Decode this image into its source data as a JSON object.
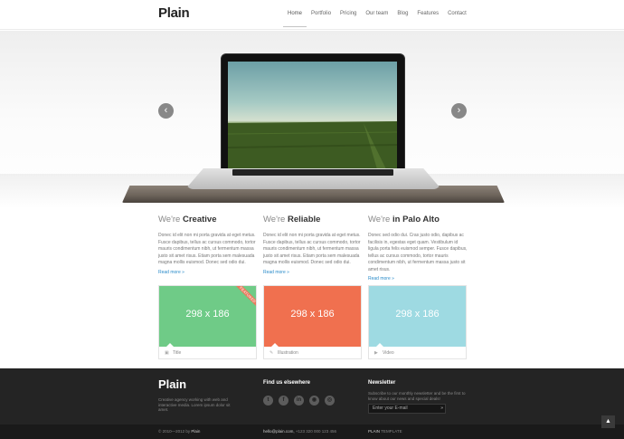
{
  "header": {
    "logo": "Plain",
    "nav": [
      "Home",
      "Portfolio",
      "Pricing",
      "Our team",
      "Blog",
      "Features",
      "Contact"
    ]
  },
  "hero": {
    "prev_icon": "chevron-left-icon",
    "next_icon": "chevron-right-icon",
    "prev_glyph": "‹",
    "next_glyph": "›"
  },
  "features": [
    {
      "prefix": "We're",
      "title": "Creative",
      "body": "Donec id elit non mi porta gravida at eget metus. Fusce dapibus, tellus ac cursus commodo, tortor mauris condimentum nibh, ut fermentum massa justo sit amet risus. Etiam porta sem malesuada magna mollis euismod. Donec sed odio dui.",
      "more": "Read more »"
    },
    {
      "prefix": "We're",
      "title": "Reliable",
      "body": "Donec id elit non mi porta gravida at eget metus. Fusce dapibus, tellus ac cursus commodo, tortor mauris condimentum nibh, ut fermentum massa justo sit amet risus. Etiam porta sem malesuada magna mollis euismod. Donec sed odio dui.",
      "more": "Read more »"
    },
    {
      "prefix": "We're",
      "title": "in Palo Alto",
      "body": "Donec sed odio dui. Cras justo odio, dapibus ac facilisis in, egestas eget quam. Vestibulum id ligula porta felis euismod semper. Fusce dapibus, tellus ac cursus commodo, tortor mauris condimentum nibh, ut fermentum massa justo sit amet risus.",
      "more": "Read more »"
    }
  ],
  "tiles": [
    {
      "dim": "298 x 186",
      "caption": "Title",
      "icon": "image-icon",
      "glyph": "▣",
      "color": "#6fcb87",
      "ribbon": "FEATURED"
    },
    {
      "dim": "298 x 186",
      "caption": "Illustration",
      "icon": "pencil-icon",
      "glyph": "✎",
      "color": "#f0704f"
    },
    {
      "dim": "298 x 186",
      "caption": "Video",
      "icon": "play-icon",
      "glyph": "▶",
      "color": "#9edae2"
    }
  ],
  "footer": {
    "logo": "Plain",
    "desc": "Creative agency working with web and interactive media. Lorem ipsum dolor sit amet.",
    "social_title": "Find us elsewhere",
    "social": [
      {
        "icon": "twitter-icon",
        "glyph": "t"
      },
      {
        "icon": "facebook-icon",
        "glyph": "f"
      },
      {
        "icon": "linkedin-icon",
        "glyph": "in"
      },
      {
        "icon": "rss-icon",
        "glyph": "◉"
      },
      {
        "icon": "dribbble-icon",
        "glyph": "◎"
      }
    ],
    "newsletter_title": "Newsletter",
    "newsletter_text": "Subscribe to our monthly newsletter and be the first to know about our news and special deals!",
    "email_placeholder": "Enter your E-mail",
    "email_go": "»"
  },
  "bottom": {
    "copyright_prefix": "© 2010—2012 by",
    "copyright_brand": "Plain",
    "contact_email": "hello@plain.com,",
    "contact_phone": "+123 320 000 123 456",
    "template_brand": "PLAIN",
    "template_label": "TEMPLATE"
  },
  "back_to_top": "▲"
}
